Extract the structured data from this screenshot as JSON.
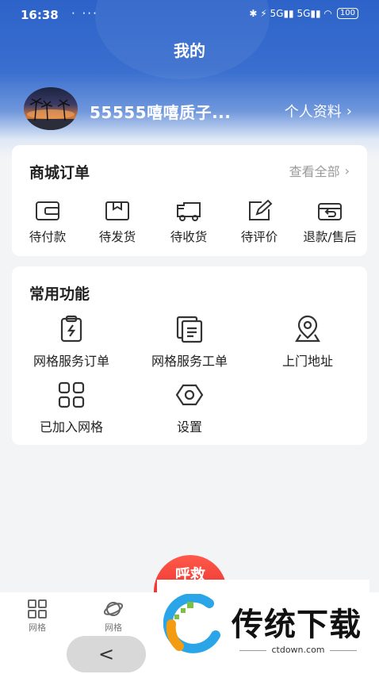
{
  "status_bar": {
    "time": "16:38",
    "extra": "·  ···",
    "icons": "✱ ⚡ 5G▮▮ 5G▮▮ ◠",
    "battery": "100"
  },
  "header": {
    "title": "我的"
  },
  "user": {
    "name": "55555嘻嘻质子...",
    "profile_label": "个人资料",
    "chevron": "›"
  },
  "orders": {
    "title": "商城订单",
    "view_all": "查看全部",
    "chevron": "›",
    "items": [
      {
        "label": "待付款",
        "icon": "wallet-icon"
      },
      {
        "label": "待发货",
        "icon": "box-icon"
      },
      {
        "label": "待收货",
        "icon": "truck-icon"
      },
      {
        "label": "待评价",
        "icon": "edit-icon"
      },
      {
        "label": "退款/售后",
        "icon": "refund-icon"
      }
    ]
  },
  "functions": {
    "title": "常用功能",
    "items": [
      {
        "label": "网格服务订单",
        "icon": "service-order-icon"
      },
      {
        "label": "网格服务工单",
        "icon": "work-order-icon"
      },
      {
        "label": "上门地址",
        "icon": "location-icon"
      },
      {
        "label": "已加入网格",
        "icon": "grid-icon"
      },
      {
        "label": "设置",
        "icon": "settings-icon"
      }
    ]
  },
  "fab": {
    "label": "呼救"
  },
  "bottom_nav": {
    "items": [
      {
        "label": "网格",
        "icon": "grid-icon"
      },
      {
        "label": "网格",
        "icon": "planet-icon"
      }
    ]
  },
  "system": {
    "back": "<"
  },
  "watermark": {
    "brand": "传统下载",
    "site": "ctdown.com"
  },
  "colors": {
    "header_blue": "#2d63c9",
    "fab_red": "#e62d2d"
  }
}
